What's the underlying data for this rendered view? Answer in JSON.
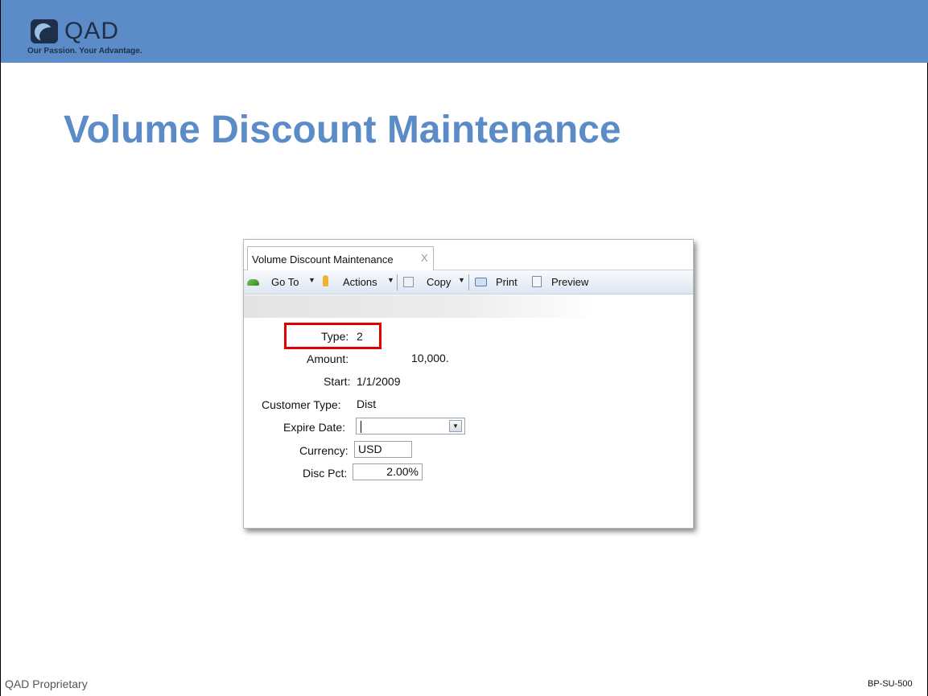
{
  "header": {
    "logo_text": "QAD",
    "tagline": "Our Passion. Your Advantage.",
    "logo_icon": "qad-globe-logo",
    "bar_color": "#5b8cc8"
  },
  "slide": {
    "title": "Volume Discount Maintenance",
    "title_color": "#5b8cc8"
  },
  "window": {
    "tab_label": "Volume Discount Maintenance",
    "tab_close": "X",
    "toolbar": {
      "goto_label": "Go To",
      "actions_label": "Actions",
      "copy_label": "Copy",
      "print_label": "Print",
      "preview_label": "Preview",
      "dropdown_glyph": "▼"
    },
    "form": {
      "type_label": "Type:",
      "type_value": "2",
      "amount_label": "Amount:",
      "amount_value": "10,000.",
      "start_label": "Start:",
      "start_value": "1/1/2009",
      "customer_type_label": "Customer Type:",
      "customer_type_value": "Dist",
      "expire_date_label": "Expire Date:",
      "expire_date_value": "",
      "currency_label": "Currency:",
      "currency_value": "USD",
      "disc_pct_label": "Disc Pct:",
      "disc_pct_value": "2.00%"
    },
    "highlight_color": "#e00000"
  },
  "footer": {
    "left": "QAD Proprietary",
    "right": "BP-SU-500"
  }
}
